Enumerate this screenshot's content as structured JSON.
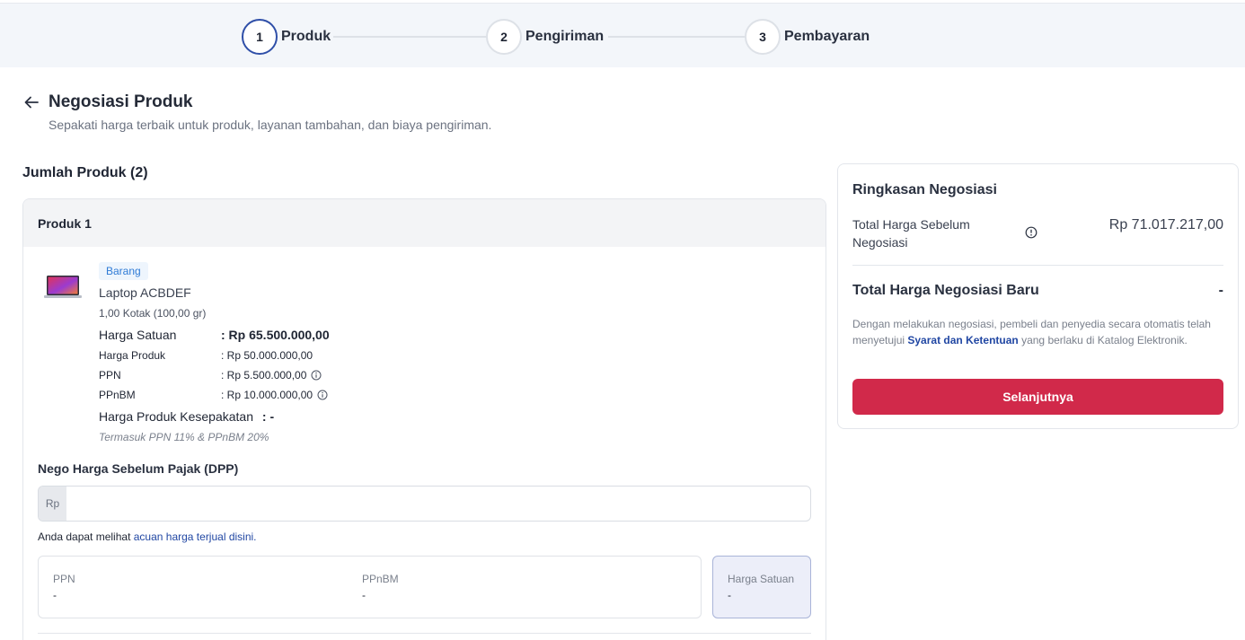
{
  "stepper": {
    "steps": [
      {
        "number": "1",
        "label": "Produk",
        "active": true
      },
      {
        "number": "2",
        "label": "Pengiriman",
        "active": false
      },
      {
        "number": "3",
        "label": "Pembayaran",
        "active": false
      }
    ]
  },
  "header": {
    "back_icon": "arrow-left-icon",
    "title": "Negosiasi Produk",
    "subtitle": "Sepakati harga terbaik untuk produk, layanan tambahan, dan biaya pengiriman."
  },
  "products_section": {
    "title": "Jumlah Produk (2)"
  },
  "product": {
    "header": "Produk 1",
    "badge": "Barang",
    "name": "Laptop ACBDEF",
    "quantity": "1,00 Kotak (100,00 gr)",
    "unit_price_label": "Harga Satuan",
    "unit_price_value": ": Rp 65.500.000,00",
    "product_price_label": "Harga Produk",
    "product_price_value": ": Rp 50.000.000,00",
    "ppn_label": "PPN",
    "ppn_value": ": Rp 5.500.000,00",
    "ppnbm_label": "PPnBM",
    "ppnbm_value": ": Rp 10.000.000,00",
    "agreed_price_label": "Harga Produk Kesepakatan",
    "agreed_price_value": ": -",
    "tax_note": "Termasuk PPN 11% & PPnBM 20%"
  },
  "negotiation": {
    "label": "Nego Harga Sebelum Pajak (DPP)",
    "prefix": "Rp",
    "value": "",
    "placeholder": "",
    "reference_text": "Anda dapat melihat ",
    "reference_link": "acuan harga terjual disini."
  },
  "tax_breakdown": {
    "ppn_label": "PPN",
    "ppn_value": "-",
    "ppnbm_label": "PPnBM",
    "ppnbm_value": "-",
    "unit_price_label": "Harga Satuan",
    "unit_price_value": "-"
  },
  "summary": {
    "title": "Ringkasan Negosiasi",
    "before_label": "Total Harga Sebelum Negosiasi",
    "before_value": "Rp 71.017.217,00",
    "new_label": "Total Harga Negosiasi Baru",
    "new_value": "-",
    "note_prefix": "Dengan melakukan negosiasi, pembeli dan penyedia secara otomatis telah menyetujui ",
    "note_link": "Syarat dan Ketentuan",
    "note_suffix": " yang berlaku di Katalog Elektronik.",
    "next_button": "Selanjutnya"
  },
  "colors": {
    "accent": "#2f4fa8",
    "primary_button": "#d1294a",
    "link": "#2147a3",
    "badge_text": "#2f7bd6"
  }
}
